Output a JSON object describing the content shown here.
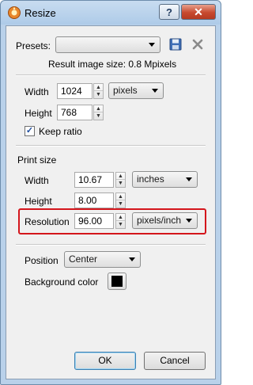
{
  "window": {
    "title": "Resize",
    "help_button": "?",
    "close_button": "✕"
  },
  "presets": {
    "label": "Presets:",
    "value": "",
    "save_icon": "save-icon",
    "delete_icon": "delete-icon"
  },
  "result": {
    "text": "Result image size: 0.8 Mpixels"
  },
  "pixel_size": {
    "width_label": "Width",
    "width_value": "1024",
    "height_label": "Height",
    "height_value": "768",
    "unit": "pixels",
    "keep_ratio_label": "Keep ratio",
    "keep_ratio_checked": true
  },
  "print_size": {
    "section_label": "Print size",
    "width_label": "Width",
    "width_value": "10.67",
    "width_unit": "inches",
    "height_label": "Height",
    "height_value": "8.00",
    "resolution_label": "Resolution",
    "resolution_value": "96.00",
    "resolution_unit": "pixels/inch"
  },
  "placement": {
    "position_label": "Position",
    "position_value": "Center",
    "background_label": "Background color",
    "background_color": "#000000"
  },
  "buttons": {
    "ok": "OK",
    "cancel": "Cancel"
  },
  "colors": {
    "highlight": "#d4161c",
    "accent": "#3c7fb1"
  }
}
